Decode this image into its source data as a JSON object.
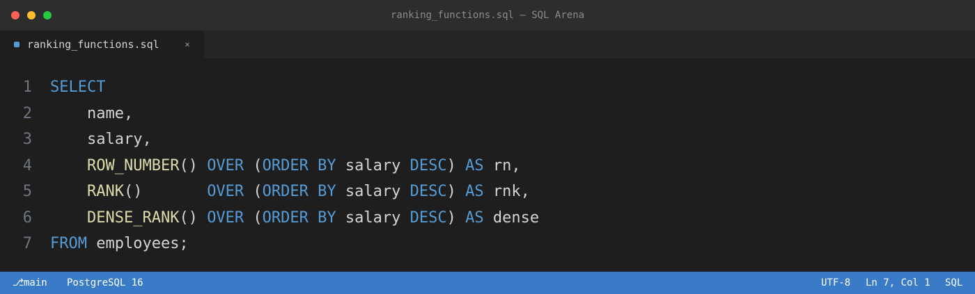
{
  "window": {
    "title": "ranking_functions.sql — SQL Arena"
  },
  "tab": {
    "label": "ranking_functions.sql",
    "close_glyph": "×",
    "modified_color": "#569cd6"
  },
  "editor": {
    "colors": {
      "keyword": "#569cd6",
      "function": "#dcdcaa",
      "plain": "#d4d4d4",
      "line_number": "#6e7681"
    },
    "lines": [
      {
        "number": "1",
        "tokens": [
          {
            "t": "kw",
            "v": "SELECT"
          }
        ]
      },
      {
        "number": "2",
        "tokens": [
          {
            "t": "pl",
            "v": "    name,"
          }
        ]
      },
      {
        "number": "3",
        "tokens": [
          {
            "t": "pl",
            "v": "    salary,"
          }
        ]
      },
      {
        "number": "4",
        "tokens": [
          {
            "t": "pl",
            "v": "    "
          },
          {
            "t": "fn",
            "v": "ROW_NUMBER"
          },
          {
            "t": "pl",
            "v": "() "
          },
          {
            "t": "kw",
            "v": "OVER"
          },
          {
            "t": "pl",
            "v": " ("
          },
          {
            "t": "kw",
            "v": "ORDER BY"
          },
          {
            "t": "pl",
            "v": " salary "
          },
          {
            "t": "kw",
            "v": "DESC"
          },
          {
            "t": "pl",
            "v": ") "
          },
          {
            "t": "kw",
            "v": "AS"
          },
          {
            "t": "pl",
            "v": " rn,"
          }
        ]
      },
      {
        "number": "5",
        "tokens": [
          {
            "t": "pl",
            "v": "    "
          },
          {
            "t": "fn",
            "v": "RANK"
          },
          {
            "t": "pl",
            "v": "()       "
          },
          {
            "t": "kw",
            "v": "OVER"
          },
          {
            "t": "pl",
            "v": " ("
          },
          {
            "t": "kw",
            "v": "ORDER BY"
          },
          {
            "t": "pl",
            "v": " salary "
          },
          {
            "t": "kw",
            "v": "DESC"
          },
          {
            "t": "pl",
            "v": ") "
          },
          {
            "t": "kw",
            "v": "AS"
          },
          {
            "t": "pl",
            "v": " rnk,"
          }
        ]
      },
      {
        "number": "6",
        "tokens": [
          {
            "t": "pl",
            "v": "    "
          },
          {
            "t": "fn",
            "v": "DENSE_RANK"
          },
          {
            "t": "pl",
            "v": "() "
          },
          {
            "t": "kw",
            "v": "OVER"
          },
          {
            "t": "pl",
            "v": " ("
          },
          {
            "t": "kw",
            "v": "ORDER BY"
          },
          {
            "t": "pl",
            "v": " salary "
          },
          {
            "t": "kw",
            "v": "DESC"
          },
          {
            "t": "pl",
            "v": ") "
          },
          {
            "t": "kw",
            "v": "AS"
          },
          {
            "t": "pl",
            "v": " dense"
          }
        ]
      },
      {
        "number": "7",
        "tokens": [
          {
            "t": "kw",
            "v": "FROM"
          },
          {
            "t": "pl",
            "v": " employees;"
          }
        ]
      }
    ]
  },
  "statusbar": {
    "background": "#3a7bc8",
    "branch_icon": "git-branch-icon",
    "branch": "main",
    "database": "PostgreSQL 16",
    "encoding": "UTF-8",
    "cursor": "Ln 7, Col 1",
    "language": "SQL"
  }
}
